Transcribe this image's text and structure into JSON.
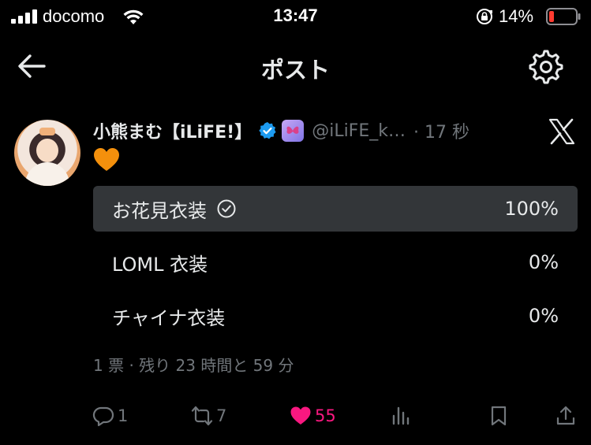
{
  "status_bar": {
    "carrier": "docomo",
    "time": "13:47",
    "battery": "14%"
  },
  "header": {
    "title": "ポスト"
  },
  "post": {
    "display_name": "小熊まむ【iLiFE!】",
    "handle": "@iLiFE_k…",
    "time_ago": "· 17 秒",
    "emoji": "orange-heart"
  },
  "poll": {
    "options": [
      {
        "label": "お花見衣装",
        "percent": "100%",
        "winner": true
      },
      {
        "label": "LOML 衣装",
        "percent": "0%",
        "winner": false
      },
      {
        "label": "チャイナ衣装",
        "percent": "0%",
        "winner": false
      }
    ],
    "meta": "1 票 · 残り 23 時間と 59 分"
  },
  "actions": {
    "replies": "1",
    "reposts": "7",
    "likes": "55"
  },
  "colors": {
    "background": "#000000",
    "text": "#e7e9ea",
    "muted": "#71767b",
    "like": "#f91880",
    "verified": "#1d9bf0",
    "poll_winner_bg": "#333639"
  }
}
